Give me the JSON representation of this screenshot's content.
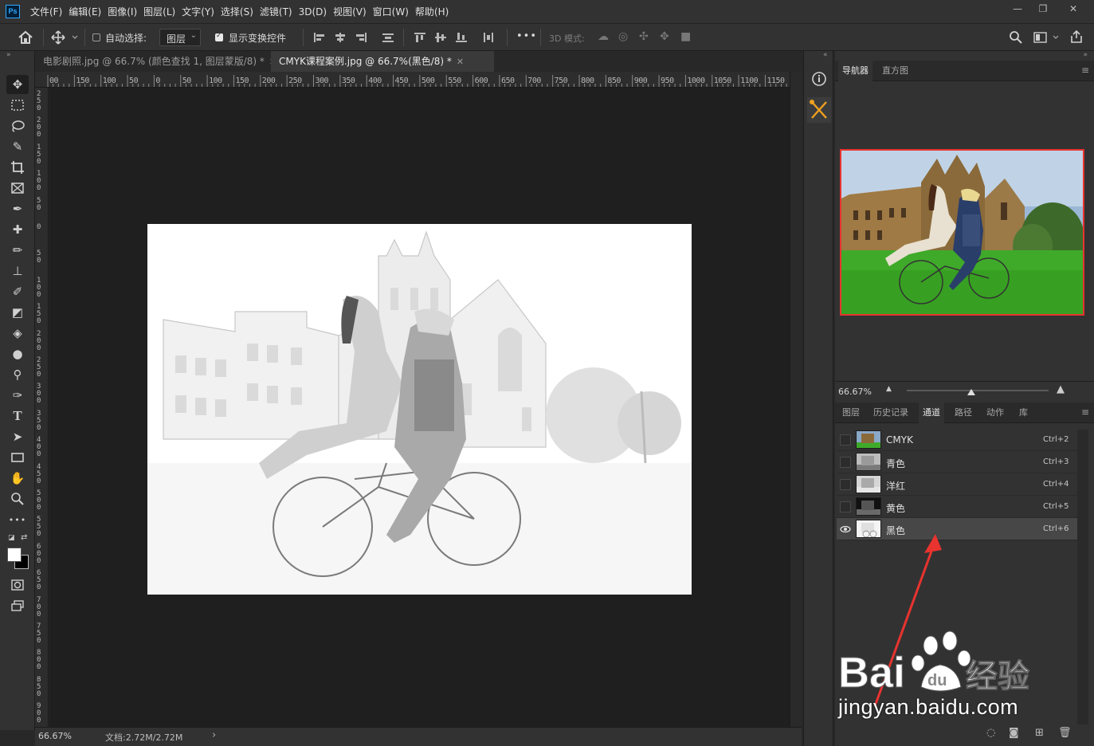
{
  "menu": {
    "logo": "Ps",
    "items": [
      "文件(F)",
      "编辑(E)",
      "图像(I)",
      "图层(L)",
      "文字(Y)",
      "选择(S)",
      "滤镜(T)",
      "3D(D)",
      "视图(V)",
      "窗口(W)",
      "帮助(H)"
    ],
    "minimize": "—",
    "restore": "❐",
    "close": "✕"
  },
  "options": {
    "auto_select_label": "自动选择:",
    "auto_select_checked": false,
    "auto_select_target": "图层",
    "show_transform_label": "显示变换控件",
    "show_transform_checked": true,
    "more": "•••",
    "mode_3d_label": "3D 模式:"
  },
  "tabs": [
    {
      "label": "电影剧照.jpg @ 66.7% (颜色查找 1, 图层蒙版/8) *",
      "active": false
    },
    {
      "label": "CMYK课程案例.jpg @ 66.7%(黑色/8) *",
      "active": true
    }
  ],
  "ruler_h": [
    "00",
    "150",
    "100",
    "50",
    "0",
    "50",
    "100",
    "150",
    "200",
    "250",
    "300",
    "350",
    "400",
    "450",
    "500",
    "550",
    "600",
    "650",
    "700",
    "750",
    "800",
    "850",
    "900",
    "950",
    "1000",
    "1050",
    "1100",
    "1150",
    "1"
  ],
  "ruler_v": [
    "250",
    "200",
    "150",
    "100",
    "50",
    "0",
    "50",
    "100",
    "150",
    "200",
    "250",
    "300",
    "350",
    "400",
    "450",
    "500",
    "550",
    "600",
    "650",
    "700",
    "750",
    "800",
    "850",
    "900"
  ],
  "status": {
    "zoom": "66.67%",
    "doc_info": "文档:2.72M/2.72M",
    "arrow": "›"
  },
  "navigator": {
    "tabs": [
      "导航器",
      "直方图"
    ],
    "zoom": "66.67%"
  },
  "channels_panel": {
    "tabs": [
      "图层",
      "历史记录",
      "通道",
      "路径",
      "动作",
      "库"
    ],
    "active_tab": "通道",
    "channels": [
      {
        "name": "CMYK",
        "shortcut": "Ctrl+2",
        "visible": false,
        "selected": false
      },
      {
        "name": "青色",
        "shortcut": "Ctrl+3",
        "visible": false,
        "selected": false
      },
      {
        "name": "洋红",
        "shortcut": "Ctrl+4",
        "visible": false,
        "selected": false
      },
      {
        "name": "黄色",
        "shortcut": "Ctrl+5",
        "visible": false,
        "selected": false
      },
      {
        "name": "黑色",
        "shortcut": "Ctrl+6",
        "visible": true,
        "selected": true
      }
    ]
  },
  "watermark": {
    "url": "jingyan.baidu.com"
  },
  "colors": {
    "accent_red": "#e8332f",
    "panel_bg": "#323232",
    "canvas_bg": "#1f1f1f"
  }
}
